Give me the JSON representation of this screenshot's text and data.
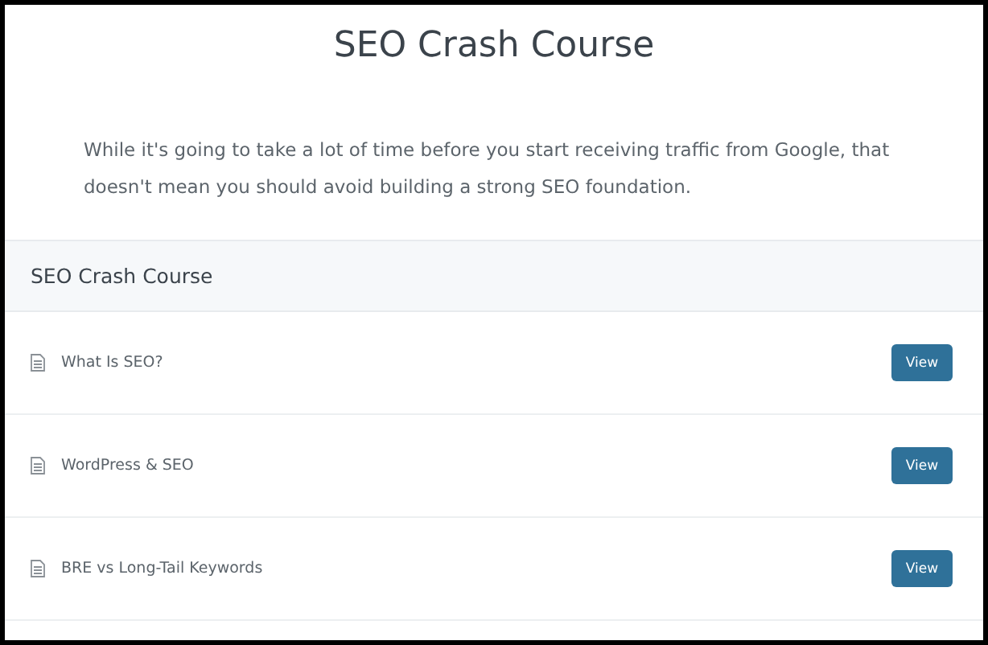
{
  "page": {
    "title": "SEO Crash Course",
    "intro": "While it's going to take a lot of time before you start receiving traffic from Google, that doesn't mean you should avoid building a strong SEO foundation."
  },
  "section": {
    "title": "SEO Crash Course",
    "lessons": [
      {
        "title": "What Is SEO?",
        "button": "View"
      },
      {
        "title": "WordPress & SEO",
        "button": "View"
      },
      {
        "title": "BRE vs Long-Tail Keywords",
        "button": "View"
      }
    ]
  }
}
